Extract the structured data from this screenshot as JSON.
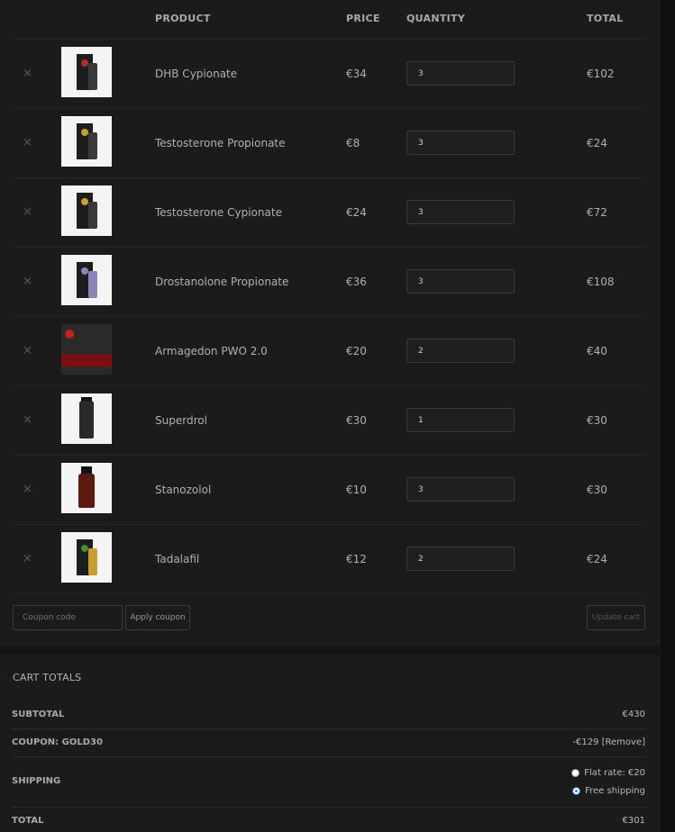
{
  "headers": {
    "product": "PRODUCT",
    "price": "PRICE",
    "quantity": "QUANTITY",
    "total": "TOTAL"
  },
  "items": [
    {
      "name": "DHB Cypionate",
      "price": "€34",
      "qty": "3",
      "total": "€102",
      "remove": "×"
    },
    {
      "name": "Testosterone Propionate",
      "price": "€8",
      "qty": "3",
      "total": "€24",
      "remove": "×"
    },
    {
      "name": "Testosterone Cypionate",
      "price": "€24",
      "qty": "3",
      "total": "€72",
      "remove": "×"
    },
    {
      "name": "Drostanolone Propionate",
      "price": "€36",
      "qty": "3",
      "total": "€108",
      "remove": "×"
    },
    {
      "name": "Armagedon PWO 2.0",
      "price": "€20",
      "qty": "2",
      "total": "€40",
      "remove": "×"
    },
    {
      "name": "Superdrol",
      "price": "€30",
      "qty": "1",
      "total": "€30",
      "remove": "×"
    },
    {
      "name": "Stanozolol",
      "price": "€10",
      "qty": "3",
      "total": "€30",
      "remove": "×"
    },
    {
      "name": "Tadalafil",
      "price": "€12",
      "qty": "2",
      "total": "€24",
      "remove": "×"
    }
  ],
  "actions": {
    "coupon_placeholder": "Coupon code",
    "apply_label": "Apply coupon",
    "update_label": "Update cart"
  },
  "totals": {
    "title": "CART TOTALS",
    "subtotal_label": "SUBTOTAL",
    "subtotal_value": "€430",
    "coupon_label": "COUPON: GOLD30",
    "coupon_value": "-€129",
    "coupon_remove": "[Remove]",
    "shipping_label": "SHIPPING",
    "flat_rate": "Flat rate: €20",
    "free_shipping": "Free shipping",
    "total_label": "TOTAL",
    "total_value": "€301"
  }
}
